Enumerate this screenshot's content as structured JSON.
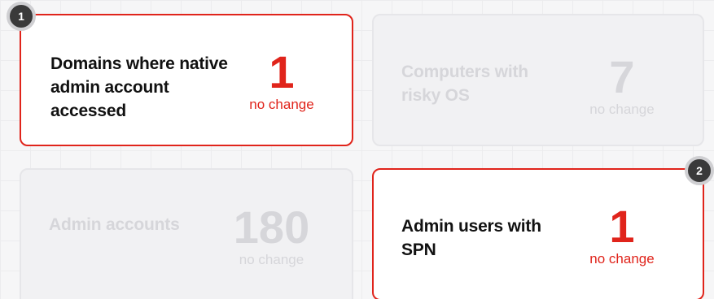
{
  "cards": [
    {
      "title": "Domains where native admin account accessed",
      "value": "1",
      "change": "no change",
      "state": "highlighted"
    },
    {
      "title": "Computers with risky OS",
      "value": "7",
      "change": "no change",
      "state": "dimmed"
    },
    {
      "title": "Admin accounts",
      "value": "180",
      "change": "no change",
      "state": "dimmed"
    },
    {
      "title": "Admin users with SPN",
      "value": "1",
      "change": "no change",
      "state": "highlighted"
    }
  ],
  "badges": [
    "1",
    "2"
  ],
  "colors": {
    "accent": "#e0241b",
    "dimmed_text": "#d6d6da",
    "badge_bg": "#3a3a3a"
  }
}
